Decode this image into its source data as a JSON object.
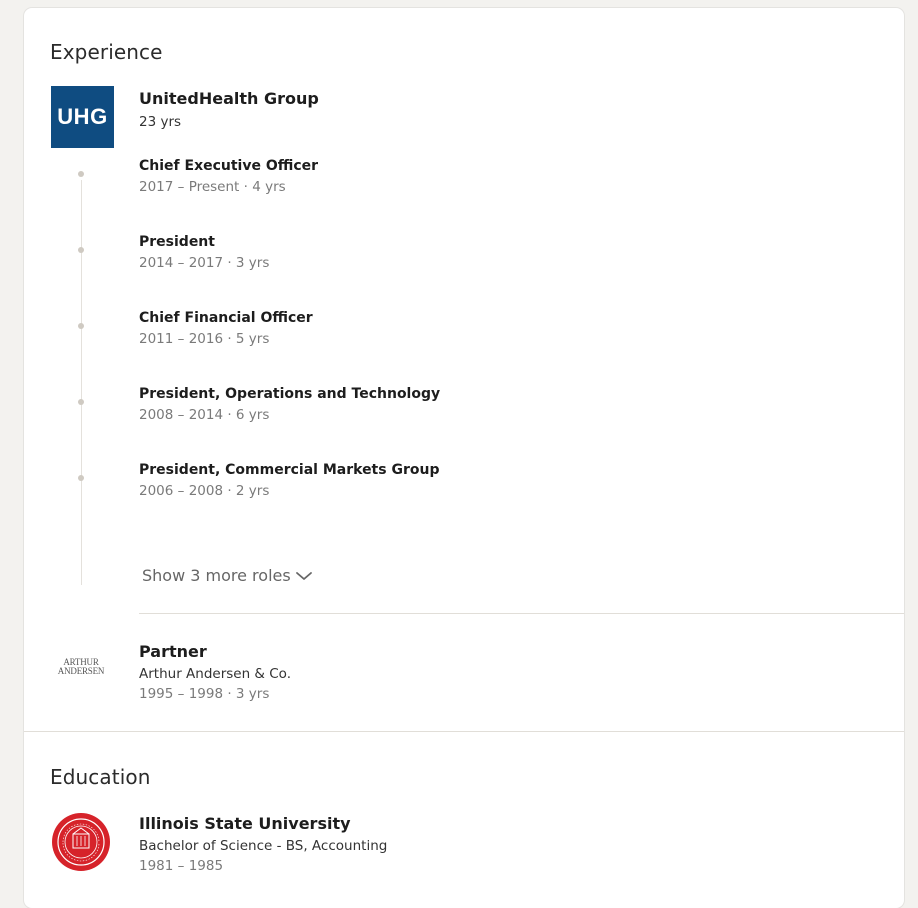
{
  "experience": {
    "section_title": "Experience",
    "uhg": {
      "logo_text": "UHG",
      "logo_color": "#0f4c81",
      "company": "UnitedHealth Group",
      "tenure": "23 yrs",
      "roles": [
        {
          "title": "Chief Executive Officer",
          "dates": "2017 – Present · 4 yrs"
        },
        {
          "title": "President",
          "dates": "2014 – 2017 · 3 yrs"
        },
        {
          "title": "Chief Financial Officer",
          "dates": "2011 – 2016 · 5 yrs"
        },
        {
          "title": "President, Operations and Technology",
          "dates": "2008 – 2014 · 6 yrs"
        },
        {
          "title": "President, Commercial Markets Group",
          "dates": "2006 – 2008 · 2 yrs"
        }
      ],
      "show_more_label": "Show 3 more roles",
      "show_more_icon": "chevron-down-icon"
    },
    "andersen": {
      "logo_text_line1": "ARTHUR",
      "logo_text_line2": "ANDERSEN",
      "title": "Partner",
      "company": "Arthur Andersen & Co.",
      "dates": "1995 – 1998 · 3 yrs"
    }
  },
  "education": {
    "section_title": "Education",
    "school": {
      "logo_color": "#d6232a",
      "name": "Illinois State University",
      "degree": "Bachelor of Science - BS, Accounting",
      "dates": "1981 – 1985"
    }
  }
}
